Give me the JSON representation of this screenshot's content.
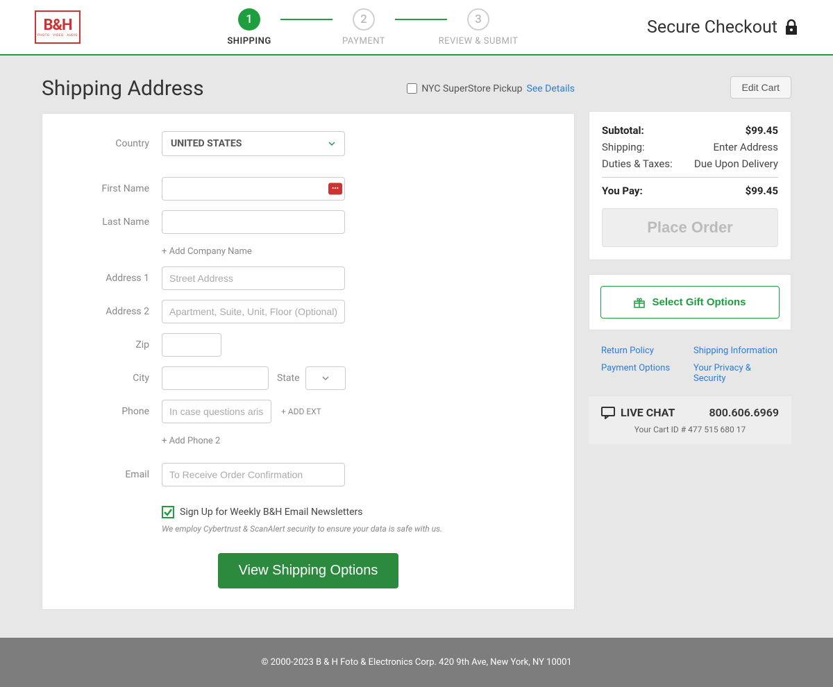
{
  "header": {
    "logo_text": "B&H",
    "logo_sub": "PHOTO · VIDEO · AUDIO",
    "secure": "Secure Checkout"
  },
  "steps": {
    "s1": {
      "num": "1",
      "label": "SHIPPING"
    },
    "s2": {
      "num": "2",
      "label": "PAYMENT"
    },
    "s3": {
      "num": "3",
      "label": "REVIEW & SUBMIT"
    }
  },
  "page": {
    "title": "Shipping Address",
    "pickup_label": "NYC SuperStore Pickup",
    "see_details": "See Details"
  },
  "form": {
    "country_label": "Country",
    "country_value": "UNITED STATES",
    "first_name_label": "First Name",
    "last_name_label": "Last Name",
    "add_company": "+ Add Company Name",
    "address1_label": "Address 1",
    "address1_placeholder": "Street Address",
    "address2_label": "Address 2",
    "address2_placeholder": "Apartment, Suite, Unit, Floor (Optional)",
    "zip_label": "Zip",
    "city_label": "City",
    "state_label": "State",
    "phone_label": "Phone",
    "phone_placeholder": "In case questions arise",
    "add_ext": "+ ADD EXT",
    "add_phone2": "+ Add Phone 2",
    "email_label": "Email",
    "email_placeholder": "To Receive Order Confirmation",
    "newsletter_label": "Sign Up for Weekly B&H Email Newsletters",
    "security_note": "We employ Cybertrust & ScanAlert security to ensure your data is safe with us.",
    "submit": "View Shipping Options"
  },
  "sidebar": {
    "edit_cart": "Edit Cart",
    "subtotal_label": "Subtotal:",
    "subtotal_value": "$99.45",
    "shipping_label": "Shipping:",
    "shipping_value": "Enter Address",
    "duties_label": "Duties & Taxes:",
    "duties_value": "Due Upon Delivery",
    "youpay_label": "You Pay:",
    "youpay_value": "$99.45",
    "place_order": "Place Order",
    "gift_options": "Select Gift Options",
    "links": {
      "return": "Return Policy",
      "shipping_info": "Shipping Information",
      "payment": "Payment Options",
      "privacy": "Your Privacy & Security"
    },
    "live_chat": "LIVE CHAT",
    "phone": "800.606.6969",
    "cart_id": "Your Cart ID # 477 515 680 17"
  },
  "footer": {
    "copyright": "© 2000-2023 B & H Foto & Electronics Corp. 420 9th Ave, New York, NY 10001"
  }
}
